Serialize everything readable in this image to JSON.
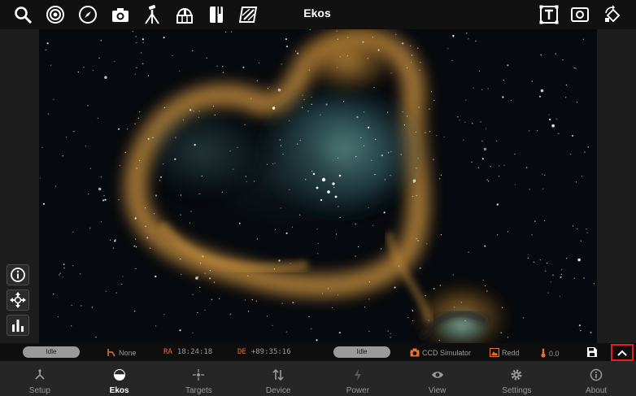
{
  "app": {
    "title": "Ekos"
  },
  "toolbar": {
    "left_icons": [
      "search-icon",
      "target-icon",
      "compass-icon",
      "camera-icon",
      "tripod-icon",
      "observatory-icon",
      "notebook-icon",
      "flat-field-icon"
    ],
    "right_icons": [
      "text-overlay-icon",
      "image-frame-icon",
      "rotate-view-icon"
    ]
  },
  "view_controls": [
    "info-icon",
    "move-icon",
    "histogram-icon"
  ],
  "status": {
    "mount_state": "Idle",
    "guide_label": "None",
    "ra_label": "RA",
    "ra_value": "18:24:18",
    "de_label": "DE",
    "de_value": "+89:35:16",
    "camera_state": "Idle",
    "camera_name": "CCD Simulator",
    "filter_name": "Redd",
    "temperature": "0.0"
  },
  "nav": [
    {
      "label": "Setup",
      "icon": "setup-icon"
    },
    {
      "label": "Ekos",
      "icon": "ekos-icon",
      "active": true
    },
    {
      "label": "Targets",
      "icon": "targets-icon"
    },
    {
      "label": "Device",
      "icon": "device-icon"
    },
    {
      "label": "Power",
      "icon": "power-icon"
    },
    {
      "label": "View",
      "icon": "view-icon"
    },
    {
      "label": "Settings",
      "icon": "settings-icon"
    },
    {
      "label": "About",
      "icon": "about-icon"
    }
  ],
  "colors": {
    "accent": "#e8702a",
    "highlight": "#e02020",
    "nav_bg": "#262626",
    "toolbar_bg": "#111111"
  }
}
